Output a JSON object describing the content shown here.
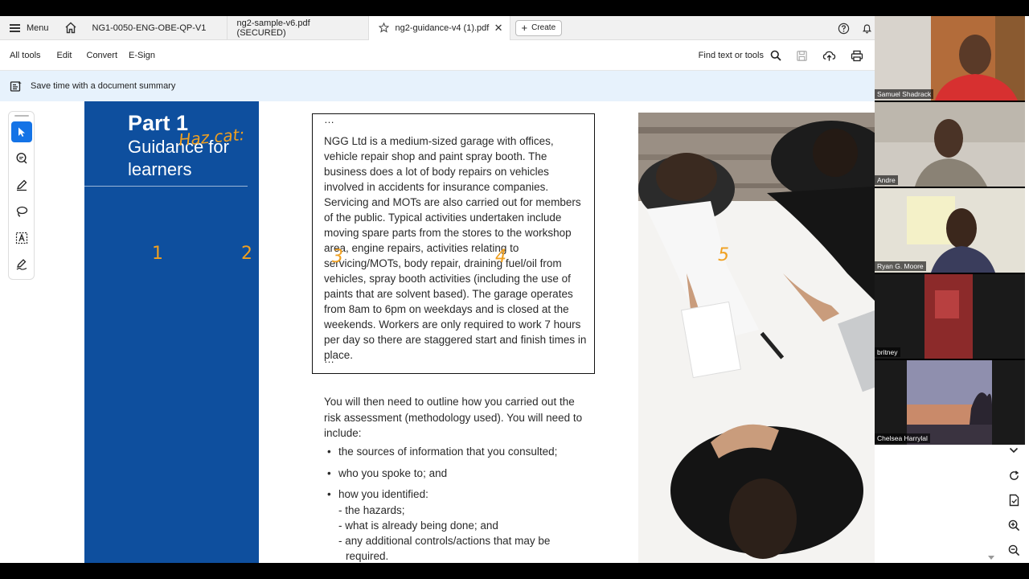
{
  "tabbar": {
    "menu_label": "Menu",
    "tabs": [
      {
        "label": "NG1-0050-ENG-OBE-QP-V1"
      },
      {
        "label": "ng2-sample-v6.pdf (SECURED)"
      },
      {
        "label": "ng2-guidance-v4 (1).pdf"
      }
    ],
    "close_glyph": "✕",
    "create_label": "Create"
  },
  "toolbar": {
    "items": [
      "All tools",
      "Edit",
      "Convert",
      "E-Sign"
    ],
    "find_label": "Find text or tools"
  },
  "banner": {
    "text": "Save time with a document summary"
  },
  "document": {
    "part_title": "Part 1",
    "part_subtitle": "Guidance for learners",
    "ellipsis": "…",
    "case_study": "NGG Ltd is a medium-sized garage with offices, vehicle repair shop and paint spray booth. The business does a lot of body repairs on vehicles involved in accidents for insurance companies. Servicing and MOTs are also carried out for members of the public. Typical activities undertaken include moving spare parts from the stores to the workshop area, engine repairs, activities relating to servicing/MOTs, body repair, draining fuel/oil from vehicles, spray booth activities (including the use of paints that are solvent based). The garage operates from 8am to 6pm on weekdays and is closed at the weekends. Workers are only required to work 7 hours per day so there are staggered start and finish times in place.",
    "instruction": "You will then need to outline how you carried out the risk assessment (methodology used). You will need to include:",
    "bullets": [
      "the sources of information that you consulted;",
      "who you spoke to; and",
      "how you identified:"
    ],
    "sub_bullets": [
      "- the hazards;",
      "- what is already being done; and",
      "- any additional controls/actions that may be",
      "required."
    ],
    "bullet_glyph": "•"
  },
  "annotations": {
    "heading": "Haz cat:",
    "numbers": [
      "1",
      "2",
      "3",
      "4",
      "5"
    ],
    "color": "#f0a020"
  },
  "participants": [
    {
      "name": "Samuel Shadrack"
    },
    {
      "name": "Andre"
    },
    {
      "name": "Ryan G. Moore"
    },
    {
      "name": "britney"
    },
    {
      "name": "Chelsea Harrylal"
    }
  ],
  "colors": {
    "accent": "#1473e6",
    "brand_blue": "#0e4f9e",
    "banner": "#e7f2fc"
  }
}
